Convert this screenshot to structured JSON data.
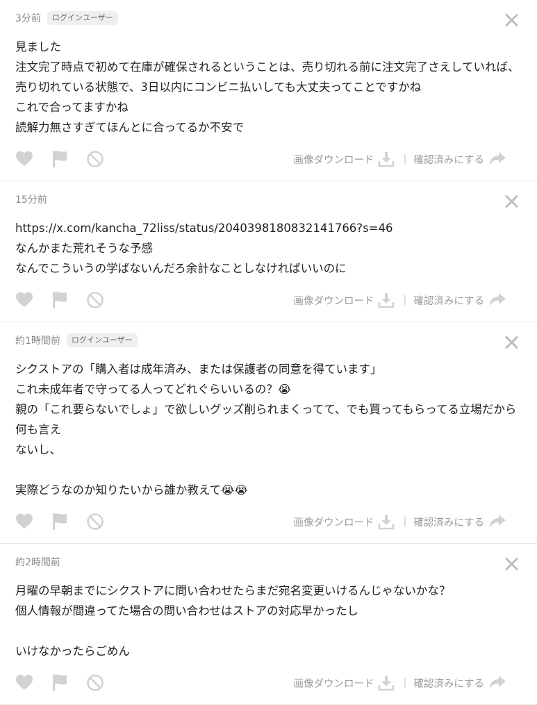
{
  "actions": {
    "download_label": "画像ダウンロード",
    "confirm_label": "確認済みにする",
    "divider": "|"
  },
  "colors": {
    "icon_gray": "#d2d2d2",
    "meta_text": "#8a8a8a",
    "badge_bg": "#efefef"
  },
  "posts": [
    {
      "time": "3分前",
      "badge": "ログインユーザー",
      "lines": [
        "見ました",
        "注文完了時点で初めて在庫が確保されるということは、売り切れる前に注文完了さえしていれば、",
        "売り切れている状態で、3日以内にコンビニ払いしても大丈夫ってことですかね",
        "これで合ってますかね",
        "読解力無さすぎてほんとに合ってるか不安で"
      ]
    },
    {
      "time": "15分前",
      "badge": "",
      "lines": [
        "https://x.com/kancha_72liss/status/2040398180832141766?s=46",
        "なんかまた荒れそうな予感",
        "なんでこういうの学ばないんだろ余計なことしなければいいのに"
      ]
    },
    {
      "time": "約1時間前",
      "badge": "ログインユーザー",
      "lines": [
        "シクストアの「購入者は成年済み、または保護者の同意を得ています」",
        "これ未成年者で守ってる人ってどれぐらいいるの？😭",
        "親の「これ要らないでしょ」で欲しいグッズ削られまくってて、でも買ってもらってる立場だから何も言え",
        "ないし、",
        "",
        "実際どうなのか知りたいから誰か教えて😭😭"
      ]
    },
    {
      "time": "約2時間前",
      "badge": "",
      "lines": [
        "月曜の早朝までにシクストアに問い合わせたらまだ宛名変更いけるんじゃないかな？",
        "個人情報が間違ってた場合の問い合わせはストアの対応早かったし",
        "",
        "いけなかったらごめん"
      ]
    }
  ]
}
